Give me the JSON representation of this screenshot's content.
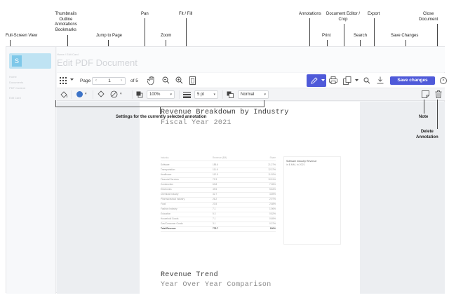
{
  "callouts": {
    "full_screen_view": "Full-Screen View",
    "thumbnails": "Thumbnails",
    "outline": "Outline",
    "annotations_bm": "Annotations",
    "bookmarks": "Bookmarks",
    "pan": "Pan",
    "fit_fill": "Fit / Fill",
    "jump_to_page": "Jump to Page",
    "zoom": "Zoom",
    "annotations": "Annotations",
    "doc_editor_1": "Document Editor /",
    "doc_editor_2": "Crop",
    "export": "Export",
    "close_1": "Close",
    "close_2": "Document",
    "print": "Print",
    "search": "Search",
    "save_changes": "Save Changes",
    "settings": "Settings for the currently selected annotation",
    "note": "Note",
    "delete_1": "Delete",
    "delete_2": "Annotation"
  },
  "app": {
    "crumb": "Home   /   Edit Card",
    "doc_title": "Edit PDF Document",
    "sidebar_items": [
      "Home",
      "Documents",
      "PDF Content",
      "Edit Card"
    ],
    "logo_glyph": "S"
  },
  "toolbar": {
    "page_label": "Page",
    "page_current": "1",
    "page_of": "of 5",
    "prev": "‹",
    "next": "›",
    "save_label": "Save changes",
    "close_glyph": "×"
  },
  "settings_bar": {
    "zoom": "100%",
    "stroke_width": "5 pt",
    "blend_mode": "Normal",
    "stroke_color": "#3d73c7"
  },
  "document": {
    "title": "Revenue Breakdown by Industry",
    "subtitle": "Fiscal Year 2021",
    "table_header": [
      "Industry",
      "Revenue ($M)",
      "Share"
    ],
    "rows": [
      [
        "Software",
        "185.6",
        "21.27%"
      ],
      [
        "Transportation",
        "111.6",
        "12.37%"
      ],
      [
        "Healthcare",
        "112.5",
        "11.92%"
      ],
      [
        "Financial Services",
        "72.3",
        "10.51%"
      ],
      [
        "Construction",
        "63.8",
        "7.35%"
      ],
      [
        "Electronics",
        "49.5",
        "5.84%"
      ],
      [
        "Chemical Industry",
        "32.7",
        "4.89%"
      ],
      [
        "Pharmaceutical Industry",
        "26.2",
        "2.97%"
      ],
      [
        "Food",
        "23.5",
        "2.68%"
      ],
      [
        "Fashion Industry",
        "7.1",
        "1.96%"
      ],
      [
        "Education",
        "5.3",
        "0.82%"
      ],
      [
        "Household Goods",
        "7.1",
        "0.65%"
      ],
      [
        "Gas/Consumer Goods",
        "3.1",
        "0.37%"
      ]
    ],
    "total_row": [
      "Total Revenue",
      "775.7",
      "100%"
    ],
    "chart_title": "Software Industry Revenue",
    "chart_subtitle": "in $ MM, in 2021",
    "section2_title": "Revenue Trend",
    "section2_subtitle": "Year Over Year Comparison"
  },
  "colors": {
    "accent": "#4f5ad9",
    "stroke": "#3d73c7"
  }
}
